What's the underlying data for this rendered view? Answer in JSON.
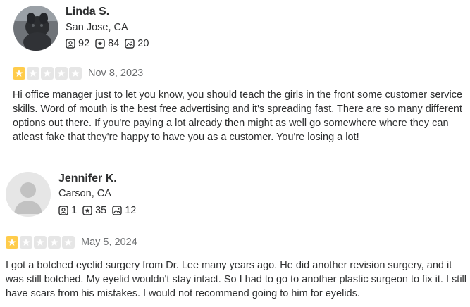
{
  "reviews": [
    {
      "name": "Linda S.",
      "location": "San Jose, CA",
      "friends": "92",
      "reviews_count": "84",
      "photos": "20",
      "rating": 1,
      "rating_max": 5,
      "date": "Nov 8, 2023",
      "text": "Hi office manager just to let you know, you should teach the girls in the front some customer service skills. Word of mouth is the best free advertising and it's spreading fast. There are so many different options out there. If you're paying a lot already then might as well go somewhere where they can atleast fake that they're happy to have you as a customer. You're losing a lot!"
    },
    {
      "name": "Jennifer K.",
      "location": "Carson, CA",
      "friends": "1",
      "reviews_count": "35",
      "photos": "12",
      "rating": 1,
      "rating_max": 5,
      "date": "May 5, 2024",
      "text": "I got a botched eyelid surgery from Dr. Lee many years ago. He did another revision surgery, and it was still botched. My eyelid wouldn't stay intact. So I had to go to another plastic surgeon to fix it. I still have scars from his mistakes. I would not recommend going to him for eyelids."
    }
  ],
  "colors": {
    "star_filled": "#ffcc4b",
    "star_empty": "#e6e6e6",
    "text": "#2d2e2f",
    "muted": "#6e7072"
  },
  "icons": {
    "friends": "friends-icon",
    "reviews": "review-star-icon",
    "photos": "photo-icon"
  }
}
